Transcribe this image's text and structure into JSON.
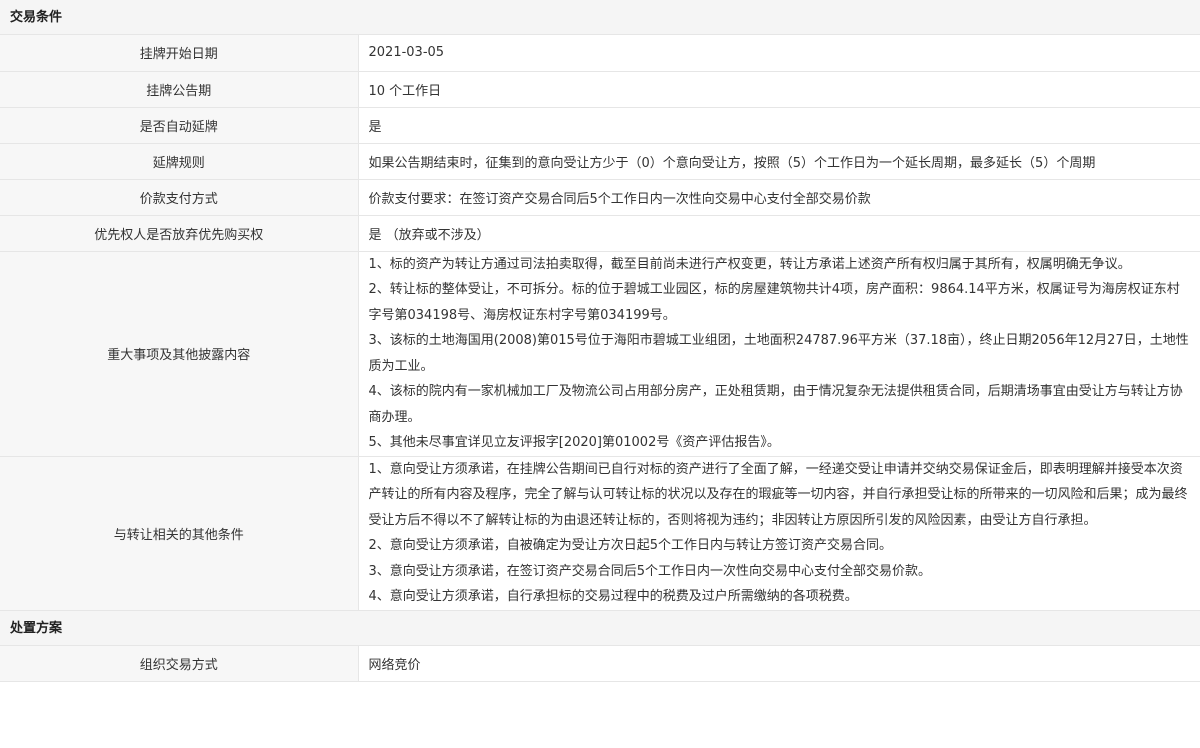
{
  "sections": [
    {
      "title": "交易条件",
      "rows": [
        {
          "label": "挂牌开始日期",
          "value": "2021-03-05"
        },
        {
          "label": "挂牌公告期",
          "value": "10 个工作日"
        },
        {
          "label": "是否自动延牌",
          "value": "是"
        },
        {
          "label": "延牌规则",
          "value": "如果公告期结束时，征集到的意向受让方少于（0）个意向受让方，按照（5）个工作日为一个延长周期，最多延长（5）个周期"
        },
        {
          "label": "价款支付方式",
          "value": "价款支付要求：在签订资产交易合同后5个工作日内一次性向交易中心支付全部交易价款"
        },
        {
          "label": "优先权人是否放弃优先购买权",
          "value": "是 （放弃或不涉及）"
        }
      ],
      "major": {
        "label": "重大事项及其他披露内容",
        "paragraphs": [
          "1、标的资产为转让方通过司法拍卖取得，截至目前尚未进行产权变更，转让方承诺上述资产所有权归属于其所有，权属明确无争议。",
          "2、转让标的整体受让，不可拆分。标的位于碧城工业园区，标的房屋建筑物共计4项，房产面积：9864.14平方米，权属证号为海房权证东村字号第034198号、海房权证东村字号第034199号。",
          "3、该标的土地海国用(2008)第015号位于海阳市碧城工业组团，土地面积24787.96平方米（37.18亩），终止日期2056年12月27日，土地性质为工业。",
          "4、该标的院内有一家机械加工厂及物流公司占用部分房产，正处租赁期，由于情况复杂无法提供租赁合同，后期清场事宜由受让方与转让方协商办理。",
          "5、其他未尽事宜详见立友评报字[2020]第01002号《资产评估报告》。"
        ]
      },
      "other": {
        "label": "与转让相关的其他条件",
        "paragraphs": [
          "1、意向受让方须承诺，在挂牌公告期间已自行对标的资产进行了全面了解，一经递交受让申请并交纳交易保证金后，即表明理解并接受本次资产转让的所有内容及程序，完全了解与认可转让标的状况以及存在的瑕疵等一切内容，并自行承担受让标的所带来的一切风险和后果；成为最终受让方后不得以不了解转让标的为由退还转让标的，否则将视为违约；非因转让方原因所引发的风险因素，由受让方自行承担。",
          "2、意向受让方须承诺，自被确定为受让方次日起5个工作日内与转让方签订资产交易合同。",
          "3、意向受让方须承诺，在签订资产交易合同后5个工作日内一次性向交易中心支付全部交易价款。",
          "4、意向受让方须承诺，自行承担标的交易过程中的税费及过户所需缴纳的各项税费。"
        ]
      }
    },
    {
      "title": "处置方案",
      "rows": [
        {
          "label": "组织交易方式",
          "value": "网络竞价"
        }
      ]
    }
  ]
}
